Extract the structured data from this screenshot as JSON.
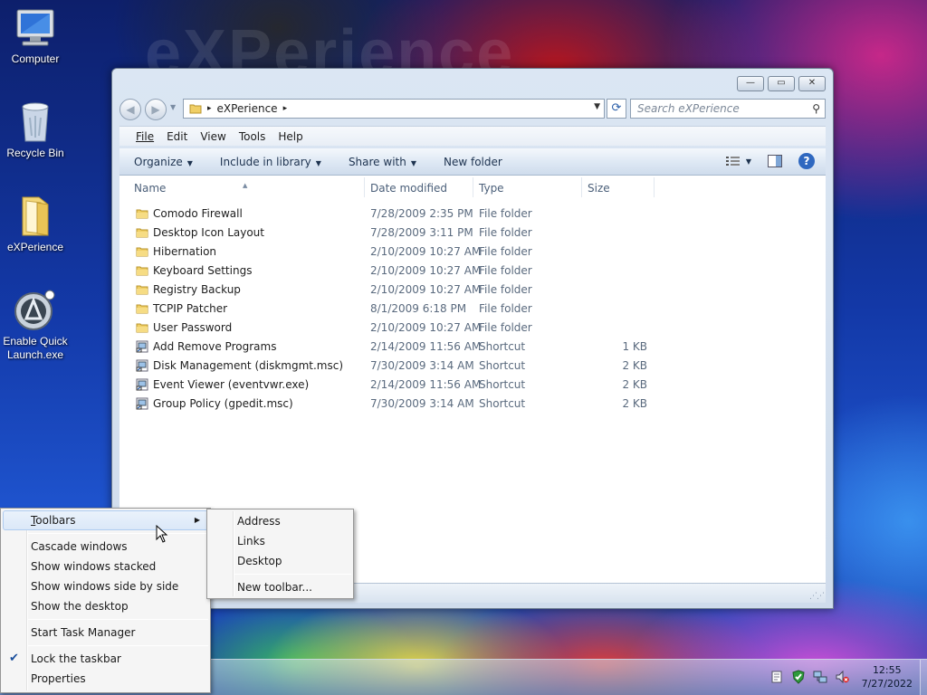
{
  "desktop": {
    "watermark": "eXPerience",
    "icons": [
      {
        "label": "Computer"
      },
      {
        "label": "Recycle Bin"
      },
      {
        "label": "eXPerience"
      },
      {
        "label": "Enable Quick Launch.exe"
      }
    ]
  },
  "window": {
    "caption": {
      "minimize": "—",
      "restore": "▭",
      "close": "✕"
    },
    "nav": {
      "back": "◀",
      "forward": "▶"
    },
    "address": {
      "path": "eXPerience",
      "sep": "▸"
    },
    "search": {
      "placeholder": "Search eXPerience"
    },
    "menu": [
      "File",
      "Edit",
      "View",
      "Tools",
      "Help"
    ],
    "commands": [
      "Organize",
      "Include in library",
      "Share with",
      "New folder"
    ],
    "columns": {
      "name": "Name",
      "date": "Date modified",
      "type": "Type",
      "size": "Size"
    },
    "rows": [
      {
        "name": "Comodo Firewall",
        "date": "7/28/2009 2:35 PM",
        "type": "File folder",
        "size": "",
        "kind": "folder"
      },
      {
        "name": "Desktop Icon Layout",
        "date": "7/28/2009 3:11 PM",
        "type": "File folder",
        "size": "",
        "kind": "folder"
      },
      {
        "name": "Hibernation",
        "date": "2/10/2009 10:27 AM",
        "type": "File folder",
        "size": "",
        "kind": "folder"
      },
      {
        "name": "Keyboard Settings",
        "date": "2/10/2009 10:27 AM",
        "type": "File folder",
        "size": "",
        "kind": "folder"
      },
      {
        "name": "Registry Backup",
        "date": "2/10/2009 10:27 AM",
        "type": "File folder",
        "size": "",
        "kind": "folder"
      },
      {
        "name": "TCPIP Patcher",
        "date": "8/1/2009 6:18 PM",
        "type": "File folder",
        "size": "",
        "kind": "folder"
      },
      {
        "name": "User Password",
        "date": "2/10/2009 10:27 AM",
        "type": "File folder",
        "size": "",
        "kind": "folder"
      },
      {
        "name": "Add Remove Programs",
        "date": "2/14/2009 11:56 AM",
        "type": "Shortcut",
        "size": "1 KB",
        "kind": "shortcut"
      },
      {
        "name": "Disk Management (diskmgmt.msc)",
        "date": "7/30/2009 3:14 AM",
        "type": "Shortcut",
        "size": "2 KB",
        "kind": "shortcut"
      },
      {
        "name": "Event Viewer (eventvwr.exe)",
        "date": "2/14/2009 11:56 AM",
        "type": "Shortcut",
        "size": "2 KB",
        "kind": "shortcut"
      },
      {
        "name": "Group Policy (gpedit.msc)",
        "date": "7/30/2009 3:14 AM",
        "type": "Shortcut",
        "size": "2 KB",
        "kind": "shortcut"
      }
    ]
  },
  "context_menu": {
    "items": {
      "toolbars": "Toolbars",
      "cascade": "Cascade windows",
      "stacked": "Show windows stacked",
      "side": "Show windows side by side",
      "desktop": "Show the desktop",
      "taskmgr": "Start Task Manager",
      "lock": "Lock the taskbar",
      "properties": "Properties"
    },
    "checked": "Lock the taskbar"
  },
  "toolbars_submenu": {
    "items": {
      "address": "Address",
      "links": "Links",
      "desktop": "Desktop",
      "new": "New toolbar..."
    }
  },
  "taskbar": {
    "time": "12:55",
    "date": "7/27/2022"
  },
  "colors": {
    "accent": "#2f68c0",
    "menu_highlight": "#dbe8f8"
  }
}
